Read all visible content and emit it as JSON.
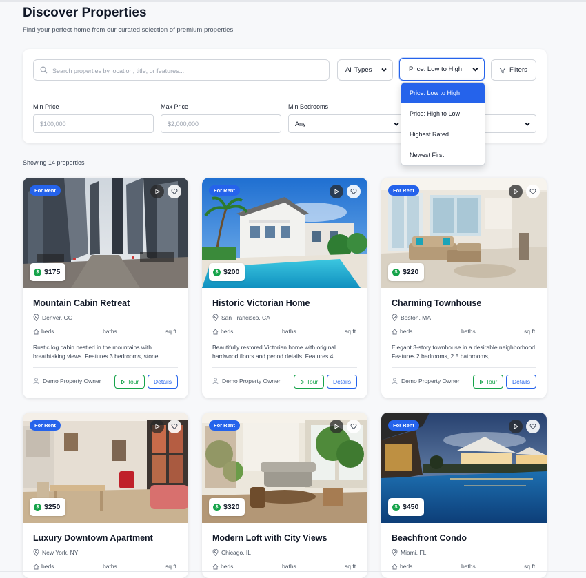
{
  "page": {
    "title": "Discover Properties",
    "subtitle": "Find your perfect home from our curated selection of premium properties",
    "showing": "Showing 14 properties"
  },
  "filters": {
    "search_placeholder": "Search properties by location, title, or features...",
    "type_select": "All Types",
    "sort_select": "Price: Low to High",
    "filters_button": "Filters",
    "min_price_label": "Min Price",
    "min_price_placeholder": "$100,000",
    "max_price_label": "Max Price",
    "max_price_placeholder": "$2,000,000",
    "min_bedrooms_label": "Min Bedrooms",
    "min_bedrooms_value": "Any"
  },
  "sort_dropdown": {
    "options": [
      "Price: Low to High",
      "Price: High to Low",
      "Highest Rated",
      "Newest First"
    ],
    "selected_index": 0
  },
  "colors": {
    "accent": "#2563eb",
    "tour": "#16a34a",
    "page_bg": "#f7f8fa"
  },
  "labels": {
    "badge": "For Rent",
    "beds": "beds",
    "baths": "baths",
    "sqft": "sq ft",
    "tour": "Tour",
    "details": "Details"
  },
  "properties": [
    {
      "title": "Mountain Cabin Retreat",
      "location": "Denver, CO",
      "price": "$175",
      "description": "Rustic log cabin nestled in the mountains with breathtaking views. Features 3 bedrooms, stone...",
      "owner": "Demo Property Owner",
      "image": "city street with skyscrapers"
    },
    {
      "title": "Historic Victorian Home",
      "location": "San Francisco, CA",
      "price": "$200",
      "description": "Beautifully restored Victorian home with original hardwood floors and period details. Features 4...",
      "owner": "Demo Property Owner",
      "image": "white house with pool and palm trees"
    },
    {
      "title": "Charming Townhouse",
      "location": "Boston, MA",
      "price": "$220",
      "description": "Elegant 3-story townhouse in a desirable neighborhood. Features 2 bedrooms, 2.5 bathrooms,...",
      "owner": "Demo Property Owner",
      "image": "bright living room with sofas"
    },
    {
      "title": "Luxury Downtown Apartment",
      "location": "New York, NY",
      "price": "$250",
      "description": "",
      "owner": "",
      "image": "apartment interior with red chair"
    },
    {
      "title": "Modern Loft with City Views",
      "location": "Chicago, IL",
      "price": "$320",
      "description": "",
      "owner": "",
      "image": "loft living room with plants"
    },
    {
      "title": "Beachfront Condo",
      "location": "Miami, FL",
      "price": "$450",
      "description": "",
      "owner": "",
      "image": "resort pool at dusk"
    }
  ]
}
